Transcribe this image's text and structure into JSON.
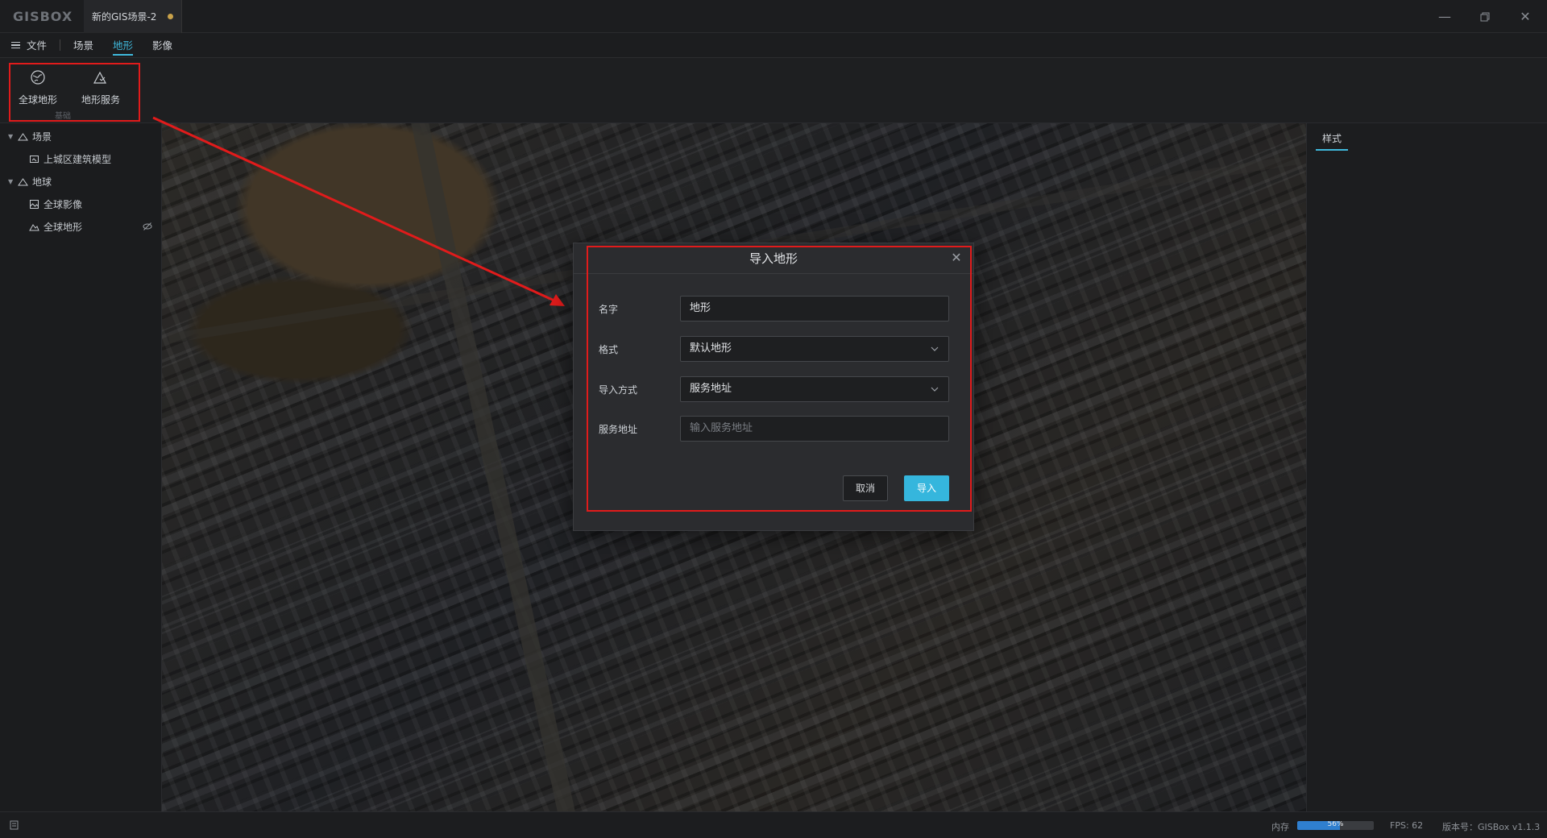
{
  "app": {
    "logo": "GISBOX",
    "doc_tab": "新的GIS场景-2"
  },
  "menu": {
    "file": "文件",
    "items": [
      "场景",
      "地形",
      "影像"
    ],
    "active": "地形"
  },
  "ribbon": {
    "tools": [
      {
        "label": "全球地形",
        "icon": "globe-terrain-icon"
      },
      {
        "label": "地形服务",
        "icon": "terrain-service-icon"
      }
    ],
    "group_label": "基础"
  },
  "tree": {
    "scene_label": "场景",
    "scene_child": "上城区建筑模型",
    "earth_label": "地球",
    "earth_children": [
      "全球影像",
      "全球地形"
    ]
  },
  "right_panel": {
    "tab": "样式"
  },
  "dialog": {
    "title": "导入地形",
    "fields": {
      "name_label": "名字",
      "name_value": "地形",
      "format_label": "格式",
      "format_value": "默认地形",
      "method_label": "导入方式",
      "method_value": "服务地址",
      "url_label": "服务地址",
      "url_placeholder": "输入服务地址"
    },
    "cancel": "取消",
    "ok": "导入"
  },
  "status": {
    "memory_label": "内存",
    "memory_percent": "56%",
    "memory_fraction": 0.56,
    "fps": "FPS: 62",
    "version": "版本号：GISBox v1.1.3"
  },
  "colors": {
    "accent": "#3fb9dc",
    "highlight": "#e11b1b"
  }
}
